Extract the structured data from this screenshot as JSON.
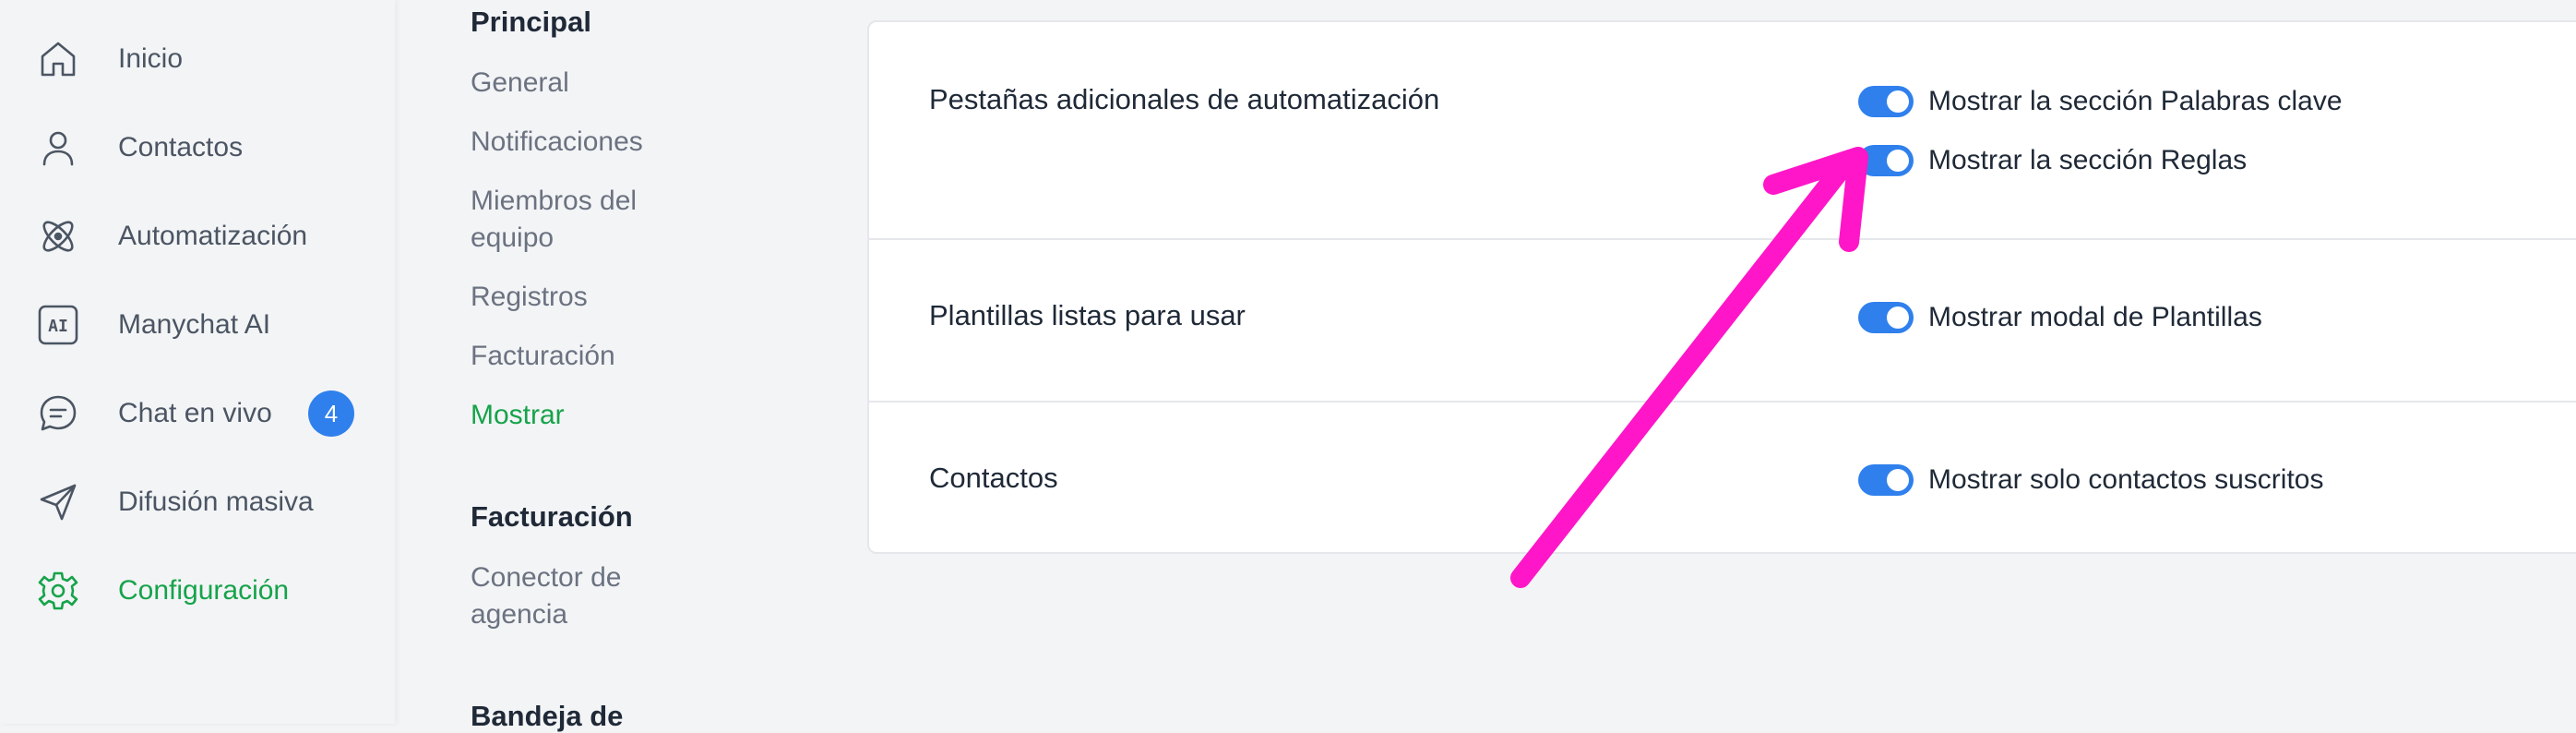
{
  "nav": {
    "items": [
      {
        "label": "Inicio",
        "icon": "home-icon"
      },
      {
        "label": "Contactos",
        "icon": "user-icon"
      },
      {
        "label": "Automatización",
        "icon": "automation-icon"
      },
      {
        "label": "Manychat AI",
        "icon": "ai-icon",
        "icon_text": "AI"
      },
      {
        "label": "Chat en vivo",
        "icon": "chat-icon",
        "badge": "4"
      },
      {
        "label": "Difusión masiva",
        "icon": "send-icon"
      },
      {
        "label": "Configuración",
        "icon": "gear-icon",
        "active": true
      }
    ]
  },
  "submenu": {
    "principal": {
      "heading": "Principal",
      "links": [
        "General",
        "Notificaciones",
        "Miembros del equipo",
        "Registros",
        "Facturación",
        "Mostrar"
      ],
      "active": "Mostrar"
    },
    "facturacion": {
      "heading": "Facturación",
      "links": [
        "Conector de agencia"
      ]
    },
    "bandeja": {
      "heading": "Bandeja de"
    }
  },
  "settings": {
    "rows": [
      {
        "title": "Pestañas adicionales de automatización",
        "toggles": [
          {
            "label": "Mostrar la sección Palabras clave",
            "on": true
          },
          {
            "label": "Mostrar la sección Reglas",
            "on": true
          }
        ]
      },
      {
        "title": "Plantillas listas para usar",
        "toggles": [
          {
            "label": "Mostrar modal de Plantillas",
            "on": true
          }
        ]
      },
      {
        "title": "Contactos",
        "toggles": [
          {
            "label": "Mostrar solo contactos suscritos",
            "on": true
          }
        ]
      }
    ]
  },
  "colors": {
    "accent_green": "#16a34a",
    "toggle_blue": "#2f80ed",
    "annotation_arrow": "#ff16c8"
  }
}
